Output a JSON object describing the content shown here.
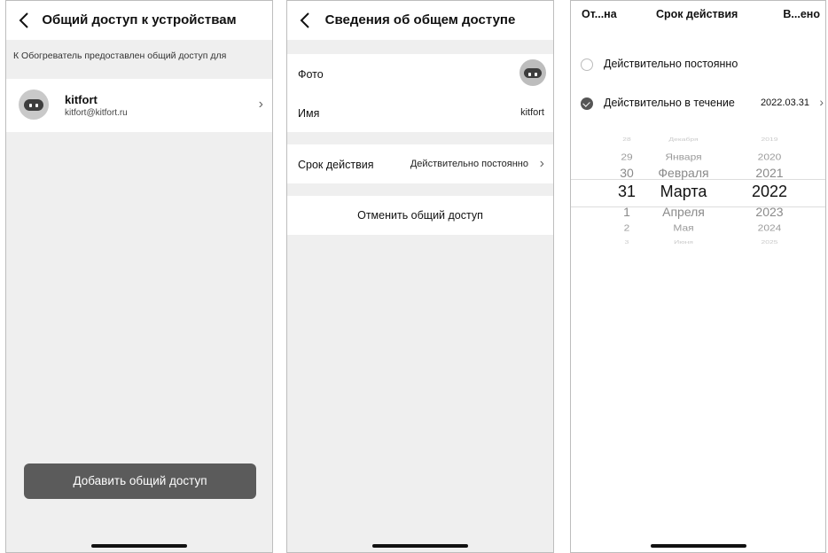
{
  "panel1": {
    "title": "Общий доступ к устройствам",
    "subheading": "К Обогреватель предоставлен общий доступ для",
    "user": {
      "name": "kitfort",
      "email": "kitfort@kitfort.ru"
    },
    "add_button": "Добавить общий доступ"
  },
  "panel2": {
    "title": "Сведения об общем доступе",
    "photo_label": "Фото",
    "name_label": "Имя",
    "name_value": "kitfort",
    "validity_label": "Срок действия",
    "validity_value": "Действительно постоянно",
    "cancel_button": "Отменить общий доступ"
  },
  "panel3": {
    "left_action": "От...на",
    "title": "Срок действия",
    "right_action": "В...ено",
    "option_permanent": "Действительно постоянно",
    "option_period": "Действительно в течение",
    "period_date": "2022.03.31",
    "selected": "period",
    "picker": {
      "days": [
        "28",
        "29",
        "30",
        "31",
        "1",
        "2",
        "3"
      ],
      "months": [
        "Декабря",
        "Января",
        "Февраля",
        "Марта",
        "Апреля",
        "Мая",
        "Июня"
      ],
      "years": [
        "2019",
        "2020",
        "2021",
        "2022",
        "2023",
        "2024",
        "2025"
      ],
      "selected_index": 3
    }
  },
  "colors": {
    "background": "#efefef",
    "button": "#5b5b5b",
    "checked": "#555555"
  },
  "icons": [
    "back-icon",
    "chevron-right-icon",
    "avatar-icon",
    "check-icon"
  ]
}
